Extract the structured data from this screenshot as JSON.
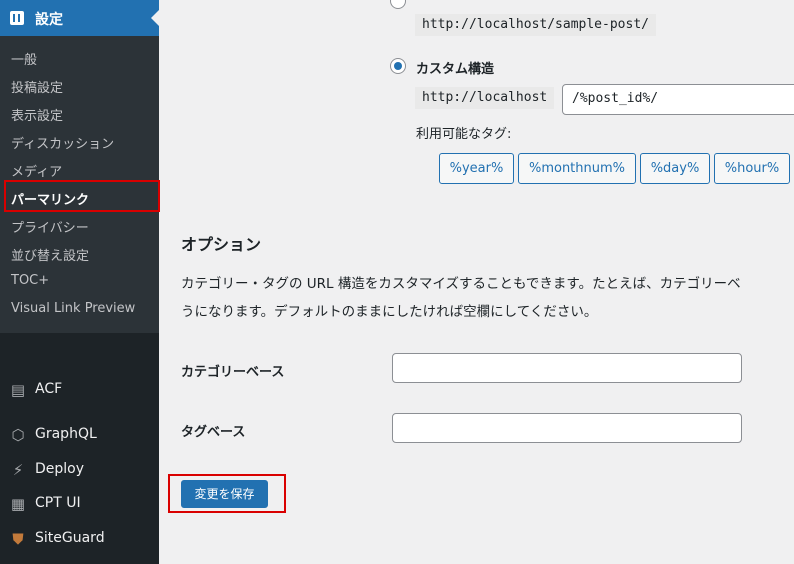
{
  "sidebar": {
    "section_title": "設定",
    "submenu": [
      "一般",
      "投稿設定",
      "表示設定",
      "ディスカッション",
      "メディア",
      "パーマリンク",
      "プライバシー",
      "並び替え設定",
      "TOC+",
      "Visual Link Preview"
    ],
    "current": "パーマリンク",
    "menu": [
      {
        "label": "ACF",
        "icon": "acf-icon"
      },
      {
        "label": "GraphQL",
        "icon": "graphql-icon"
      },
      {
        "label": "Deploy",
        "icon": "deploy-icon"
      },
      {
        "label": "CPT UI",
        "icon": "cpt-ui-icon"
      },
      {
        "label": "SiteGuard",
        "icon": "siteguard-icon"
      }
    ]
  },
  "permalink": {
    "above_code": "http://localhost/sample-post/",
    "custom_label": "カスタム構造",
    "base_url": "http://localhost",
    "custom_value": "/%post_id%/",
    "tags_label": "利用可能なタグ:",
    "tags": [
      "%year%",
      "%monthnum%",
      "%day%",
      "%hour%"
    ]
  },
  "options": {
    "heading": "オプション",
    "desc_line1": "カテゴリー・タグの URL 構造をカスタマイズすることもできます。たとえば、カテゴリーベ",
    "desc_line2": "うになります。デフォルトのままにしたければ空欄にしてください。",
    "category_base_label": "カテゴリーベース",
    "category_base_value": "",
    "tag_base_label": "タグベース",
    "tag_base_value": ""
  },
  "save_label": "変更を保存"
}
